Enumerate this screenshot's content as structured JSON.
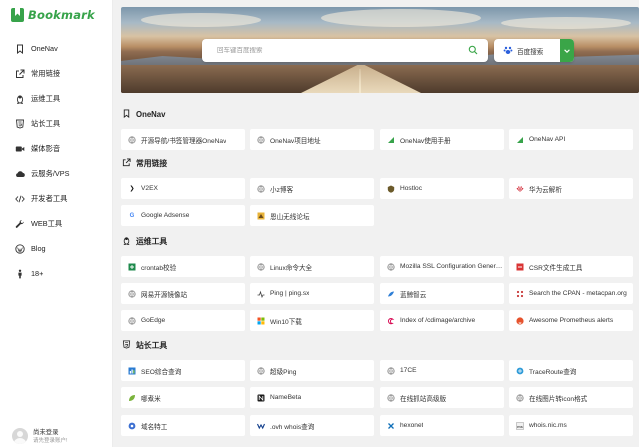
{
  "brand": {
    "name": "Bookmark",
    "color": "#37a34a"
  },
  "sidebar": {
    "items": [
      {
        "label": "OneNav",
        "icon": "bookmark-icon"
      },
      {
        "label": "常用链接",
        "icon": "external-link-icon"
      },
      {
        "label": "运维工具",
        "icon": "linux-penguin-icon"
      },
      {
        "label": "站长工具",
        "icon": "html5-icon"
      },
      {
        "label": "媒体影音",
        "icon": "video-camera-icon"
      },
      {
        "label": "云服务/VPS",
        "icon": "cloud-icon"
      },
      {
        "label": "开发者工具",
        "icon": "code-icon"
      },
      {
        "label": "WEB工具",
        "icon": "wrench-icon"
      },
      {
        "label": "Blog",
        "icon": "wordpress-icon"
      },
      {
        "label": "18+",
        "icon": "person-icon"
      }
    ]
  },
  "user": {
    "name": "尚未登录",
    "subtitle": "请先登录账户!"
  },
  "search": {
    "placeholder": "回车键百度搜索",
    "engine_label": "百度搜索",
    "accent": "#3aa548"
  },
  "sections": [
    {
      "title": "OneNav",
      "icon": "bookmark-icon",
      "links": [
        {
          "label": "开源导航/书签管理器OneNav",
          "icon": "globe-icon"
        },
        {
          "label": "OneNav项目地址",
          "icon": "globe-icon"
        },
        {
          "label": "OneNav使用手册",
          "icon": "onenav-logo-icon"
        },
        {
          "label": "OneNav API",
          "icon": "onenav-logo-icon"
        }
      ]
    },
    {
      "title": "常用链接",
      "icon": "external-link-icon",
      "links": [
        {
          "label": "V2EX",
          "icon": "v2ex-icon"
        },
        {
          "label": "小z博客",
          "icon": "globe-icon"
        },
        {
          "label": "Hostloc",
          "icon": "hostloc-icon"
        },
        {
          "label": "华为云解析",
          "icon": "huawei-icon"
        },
        {
          "label": "Google Adsense",
          "icon": "google-icon"
        },
        {
          "label": "恩山无线论坛",
          "icon": "enshan-icon"
        }
      ]
    },
    {
      "title": "运维工具",
      "icon": "linux-penguin-icon",
      "links": [
        {
          "label": "crontab校验",
          "icon": "crontab-icon"
        },
        {
          "label": "Linux命令大全",
          "icon": "globe-icon"
        },
        {
          "label": "Mozilla SSL Configuration Generator",
          "icon": "globe-icon"
        },
        {
          "label": "CSR文件生成工具",
          "icon": "csr-icon"
        },
        {
          "label": "网易开源镜像站",
          "icon": "globe-icon"
        },
        {
          "label": "Ping | ping.sx",
          "icon": "ping-icon"
        },
        {
          "label": "蓝鲸智云",
          "icon": "bluking-icon"
        },
        {
          "label": "Search the CPAN - metacpan.org",
          "icon": "cpan-icon"
        },
        {
          "label": "GoEdge",
          "icon": "globe-icon"
        },
        {
          "label": "Win10下载",
          "icon": "windows-icon"
        },
        {
          "label": "Index of /cdimage/archive",
          "icon": "debian-icon"
        },
        {
          "label": "Awesome Prometheus alerts",
          "icon": "prometheus-icon"
        }
      ]
    },
    {
      "title": "站长工具",
      "icon": "html5-icon",
      "links": [
        {
          "label": "SEO综合查询",
          "icon": "seo-icon"
        },
        {
          "label": "超级Ping",
          "icon": "globe-icon"
        },
        {
          "label": "17CE",
          "icon": "globe-icon"
        },
        {
          "label": "TraceRoute查询",
          "icon": "traceroute-icon"
        },
        {
          "label": "哪煮米",
          "icon": "leaf-icon"
        },
        {
          "label": "NameBeta",
          "icon": "namebeta-icon"
        },
        {
          "label": "在线抓站高级版",
          "icon": "globe-icon"
        },
        {
          "label": "在线图片转icon格式",
          "icon": "globe-icon"
        },
        {
          "label": "域名特工",
          "icon": "domain-agent-icon"
        },
        {
          "label": ".ovh whois查询",
          "icon": "ovh-icon"
        },
        {
          "label": "hexonet",
          "icon": "hexonet-icon"
        },
        {
          "label": "whois.nic.ms",
          "icon": "whois-icon"
        }
      ]
    }
  ]
}
